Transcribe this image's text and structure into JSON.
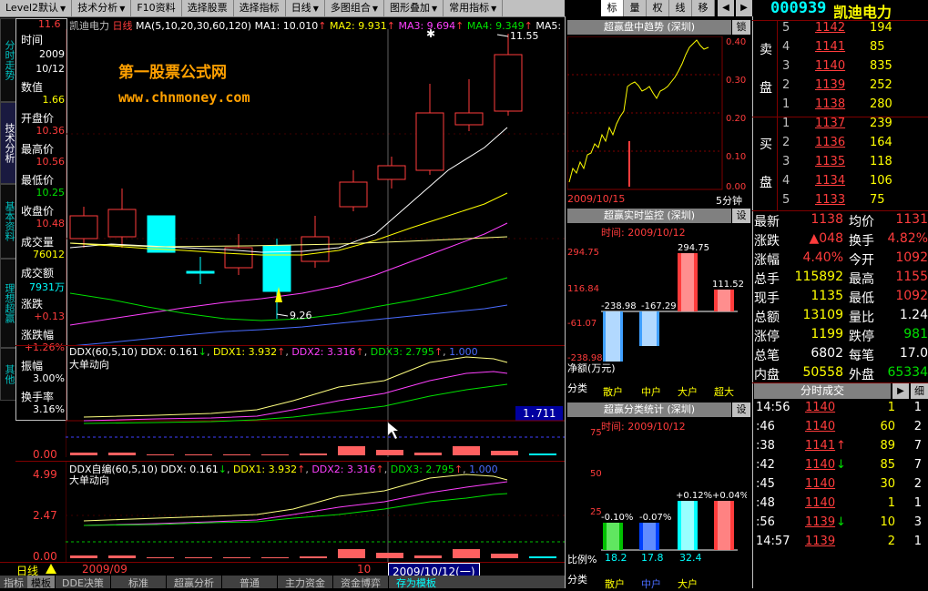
{
  "toolbar": {
    "items": [
      "Level2默认",
      "技术分析",
      "F10资料",
      "选择股票",
      "选择指标",
      "日线",
      "多图组合",
      "图形叠加",
      "常用指标"
    ],
    "right_tabs": [
      "标",
      "量",
      "权",
      "线",
      "移"
    ],
    "stock_code": "000939",
    "stock_name": "凯迪电力"
  },
  "side_tabs": [
    "分时走势",
    "技术分析",
    "基本资料",
    "理想超赢",
    "其他"
  ],
  "info_panel": {
    "time_label": "时间",
    "time_year": "2009",
    "time_date": "10/12",
    "value_label": "数值",
    "value": "1.66",
    "open_label": "开盘价",
    "open": "10.36",
    "high_label": "最高价",
    "high": "10.56",
    "low_label": "最低价",
    "low": "10.25",
    "close_label": "收盘价",
    "close": "10.48",
    "volume_label": "成交量",
    "volume": "76012",
    "amount_label": "成交额",
    "amount": "7931万",
    "change_label": "涨跌",
    "change": "+0.13",
    "pct_label": "涨跌幅",
    "pct": "+1.26%",
    "amp_label": "振幅",
    "amp": "3.00%",
    "turnover_label": "换手率",
    "turnover": "3.16%"
  },
  "main_chart": {
    "title": "凯迪电力",
    "period": "日线",
    "ma_label": "MA(5,10,20,30,60,120)",
    "ma1": "MA1: 10.010",
    "ma2": "MA2: 9.931",
    "ma3": "MA3: 9.694",
    "ma4": "MA4: 9.349",
    "ma5": "MA5:",
    "watermark1": "第一股票公式网",
    "watermark2": "www.chnmoney.com",
    "high_note": "11.55",
    "low_note": "9.26",
    "left_mark": "11.6"
  },
  "ddx1": {
    "title": "DDX(60,5,10)",
    "ddx": "DDX: 0.161",
    "ddx1": "DDX1: 3.932",
    "ddx2": "DDX2: 3.316",
    "ddx3": "DDX3: 2.795",
    "val": "1.000",
    "subtitle": "大单动向",
    "axis_zero": "0.00",
    "box_value": "1.711"
  },
  "ddx2": {
    "title": "DDX自编(60,5,10)",
    "ddx": "DDX: 0.161",
    "ddx1": "DDX1: 3.932",
    "ddx2": "DDX2: 3.316",
    "ddx3": "DDX3: 2.795",
    "val": "1.000",
    "subtitle": "大单动向",
    "axis_top": "4.99",
    "axis_mid": "2.47",
    "axis_zero": "0.00"
  },
  "bottom_status": {
    "period": "日线",
    "month": "2009/09",
    "ten": "10",
    "date": "2009/10/12(一)"
  },
  "bottom_tabs": [
    "指标",
    "模板",
    "DDE决策",
    "标准",
    "超赢分析",
    "普通",
    "主力资金",
    "资金博弈",
    "存为模板"
  ],
  "trend_panel": {
    "title": "超赢盘中趋势 (深圳)",
    "lock": "锁",
    "axis": [
      "0.40",
      "0.30",
      "0.20",
      "0.10",
      "0.00"
    ],
    "date": "2009/10/15",
    "period": "5分钟"
  },
  "monitor_panel": {
    "title": "超赢实时监控 (深圳)",
    "set": "设",
    "time": "时间: 2009/10/12",
    "axis": [
      "294.75",
      "116.84",
      "-61.07",
      "-238.98"
    ],
    "values": [
      "-238.98",
      "-167.29",
      "294.75",
      "111.52"
    ],
    "net_label": "净额(万元)",
    "cat_label": "分类",
    "cats": [
      "散户",
      "中户",
      "大户",
      "超大"
    ]
  },
  "stats_panel": {
    "title": "超赢分类统计 (深圳)",
    "set": "设",
    "time": "时间: 2009/10/12",
    "axis": [
      "75",
      "50",
      "25"
    ],
    "values": [
      "-0.10%",
      "-0.07%",
      "+0.12%",
      "+0.04%"
    ],
    "ratios": [
      "18.2",
      "17.8",
      "32.4"
    ],
    "ratio_label": "比例%",
    "cat_label": "分类",
    "cats": [
      "散户",
      "中户",
      "大户"
    ]
  },
  "order_book": {
    "sell_label1": "卖",
    "sell_label2": "盘",
    "buy_label1": "买",
    "buy_label2": "盘",
    "sell": [
      [
        "5",
        "1142",
        "194"
      ],
      [
        "4",
        "1141",
        "85"
      ],
      [
        "3",
        "1140",
        "835"
      ],
      [
        "2",
        "1139",
        "252"
      ],
      [
        "1",
        "1138",
        "280"
      ]
    ],
    "buy": [
      [
        "1",
        "1137",
        "239"
      ],
      [
        "2",
        "1136",
        "164"
      ],
      [
        "3",
        "1135",
        "118"
      ],
      [
        "4",
        "1134",
        "106"
      ],
      [
        "5",
        "1133",
        "75"
      ]
    ]
  },
  "quote": [
    [
      "最新",
      "1138",
      "均价",
      "1131"
    ],
    [
      "涨跌",
      "▲048",
      "换手",
      "4.82%"
    ],
    [
      "涨幅",
      "4.40%",
      "今开",
      "1092"
    ],
    [
      "总手",
      "115892",
      "最高",
      "1155"
    ],
    [
      "现手",
      "1135",
      "最低",
      "1092"
    ],
    [
      "总额",
      "13109",
      "量比",
      "1.24"
    ],
    [
      "涨停",
      "1199",
      "跌停",
      "981"
    ],
    [
      "总笔",
      "6802",
      "每笔",
      "17.0"
    ],
    [
      "内盘",
      "50558",
      "外盘",
      "65334"
    ]
  ],
  "ticks": {
    "header": "分时成交",
    "next": "▶",
    "detail": "细",
    "rows": [
      [
        "14:56",
        "1140",
        "",
        "1",
        "1"
      ],
      [
        ":46",
        "1140",
        "",
        "60",
        "2"
      ],
      [
        ":38",
        "1141",
        "↑",
        "89",
        "7"
      ],
      [
        ":42",
        "1140",
        "↓",
        "85",
        "7"
      ],
      [
        ":45",
        "1140",
        "",
        "30",
        "2"
      ],
      [
        ":48",
        "1140",
        "",
        "1",
        "1"
      ],
      [
        ":56",
        "1139",
        "↓",
        "10",
        "3"
      ],
      [
        "14:57",
        "1139",
        "",
        "2",
        "1"
      ]
    ]
  },
  "colors": {
    "up": "#ff3c3c",
    "down": "#00ffff",
    "ma1": "#ffffff",
    "ma2": "#ffff00",
    "ma3": "#ff40ff",
    "ma4": "#00e000",
    "ma5": "#4a6cff",
    "grid": "#800000"
  }
}
